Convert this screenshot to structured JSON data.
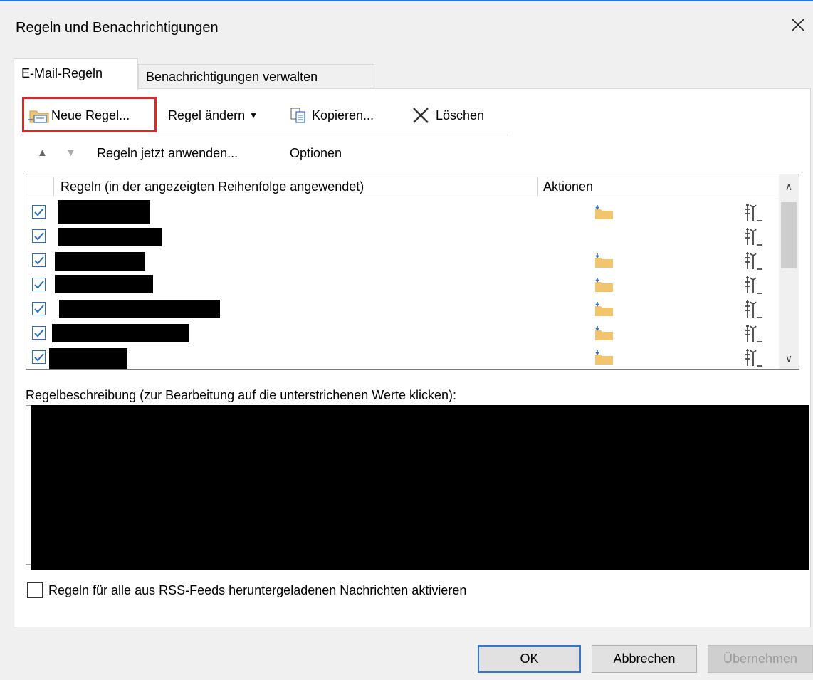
{
  "window": {
    "title": "Regeln und Benachrichtigungen",
    "close_glyph": "✕"
  },
  "tabs": [
    {
      "label": "E-Mail-Regeln",
      "active": true
    },
    {
      "label": "Benachrichtigungen verwalten",
      "active": false
    }
  ],
  "toolbar": {
    "new_rule": "Neue Regel...",
    "change_rule": "Regel ändern",
    "copy": "Kopieren...",
    "delete": "Löschen"
  },
  "actions_row": {
    "apply_now": "Regeln jetzt anwenden...",
    "options": "Optionen"
  },
  "rules_list": {
    "columns": [
      "Regeln (in der angezeigten Reihenfolge angewendet)",
      "Aktionen"
    ],
    "rows": [
      {
        "checked": true,
        "name": "",
        "has_move_icon": true
      },
      {
        "checked": true,
        "name": "",
        "has_move_icon": false
      },
      {
        "checked": true,
        "name": "",
        "has_move_icon": true
      },
      {
        "checked": true,
        "name": "",
        "has_move_icon": true
      },
      {
        "checked": true,
        "name": "",
        "has_move_icon": true
      },
      {
        "checked": true,
        "name": "",
        "has_move_icon": true
      },
      {
        "checked": true,
        "name": "",
        "has_move_icon": true
      }
    ]
  },
  "description": {
    "label": "Regelbeschreibung (zur Bearbeitung auf die unterstrichenen Werte klicken):",
    "text": ""
  },
  "rss_option": {
    "label": "Regeln für alle aus RSS-Feeds heruntergeladenen Nachrichten aktivieren",
    "checked": false
  },
  "buttons": {
    "ok": "OK",
    "cancel": "Abbrechen",
    "apply": "Übernehmen"
  },
  "colors": {
    "accent": "#2b79d8",
    "highlight_red": "#e0252b",
    "folder": "#f2c46d"
  }
}
